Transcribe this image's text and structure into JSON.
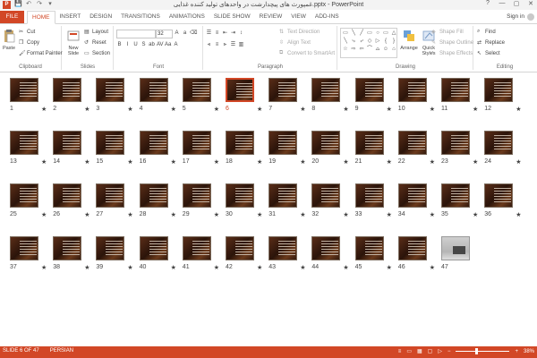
{
  "window": {
    "title": "غمپورث های پیچدارشت در واحدهای تولید کننده غذایی.pptx - PowerPoint",
    "app_letter": "P",
    "signin": "Sign in",
    "controls": [
      "?",
      "—",
      "▢",
      "✕"
    ]
  },
  "quick_access": [
    "💾",
    "↶",
    "↷",
    "▾"
  ],
  "tabs": {
    "file": "FILE",
    "items": [
      "HOME",
      "INSERT",
      "DESIGN",
      "TRANSITIONS",
      "ANIMATIONS",
      "SLIDE SHOW",
      "REVIEW",
      "VIEW",
      "ADD-INS"
    ],
    "active": "HOME"
  },
  "ribbon": {
    "clipboard": {
      "label": "Clipboard",
      "paste": "Paste",
      "cut": "Cut",
      "copy": "Copy",
      "format_painter": "Format Painter"
    },
    "slides": {
      "label": "Slides",
      "new_slide": "New Slide",
      "layout": "Layout",
      "reset": "Reset",
      "section": "Section"
    },
    "font": {
      "label": "Font",
      "size": "32",
      "buttons": [
        "B",
        "I",
        "U",
        "S",
        "ab",
        "AV",
        "Aa",
        "A"
      ]
    },
    "paragraph": {
      "label": "Paragraph",
      "text_direction": "Text Direction",
      "align_text": "Align Text",
      "convert_smartart": "Convert to SmartArt"
    },
    "drawing": {
      "label": "Drawing",
      "arrange": "Arrange",
      "quick_styles": "Quick Styles",
      "shape_fill": "Shape Fill",
      "shape_outline": "Shape Outline",
      "shape_effects": "Shape Effects",
      "shapes": [
        "▭",
        "╲",
        "╱",
        "▭",
        "○",
        "▭",
        "△",
        "╲",
        "⤷",
        "⤶",
        "◇",
        "▷",
        "{",
        "}",
        "☆",
        "⇨",
        "⇦",
        "⌒",
        "⌓",
        "☺",
        "⌂"
      ]
    },
    "editing": {
      "label": "Editing",
      "find": "Find",
      "replace": "Replace",
      "select": "Select"
    }
  },
  "slides": {
    "total": 47,
    "selected": 6,
    "photo_slide": 47,
    "numbers": [
      "1",
      "2",
      "3",
      "4",
      "5",
      "6",
      "7",
      "8",
      "9",
      "10",
      "11",
      "12",
      "13",
      "14",
      "15",
      "16",
      "17",
      "18",
      "19",
      "20",
      "21",
      "22",
      "23",
      "24",
      "25",
      "26",
      "27",
      "28",
      "29",
      "30",
      "31",
      "32",
      "33",
      "34",
      "35",
      "36",
      "37",
      "38",
      "39",
      "40",
      "41",
      "42",
      "43",
      "44",
      "45",
      "46",
      "47"
    ],
    "star": "★"
  },
  "status": {
    "slide_info": "SLIDE 6 OF 47",
    "language": "PERSIAN",
    "zoom_minus": "−",
    "zoom_plus": "+",
    "zoom": "38%",
    "zoom_fraction": 0.38
  },
  "colors": {
    "accent": "#d24726",
    "slide_bg": "#3a1e12"
  }
}
